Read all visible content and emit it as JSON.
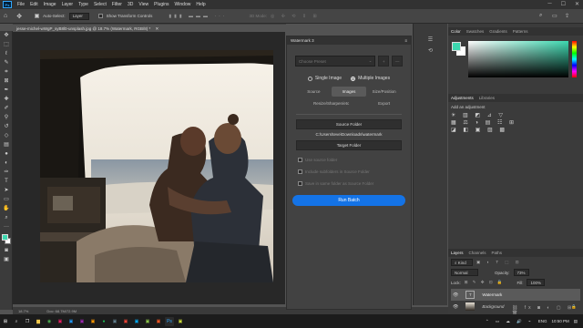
{
  "menu": {
    "app_badge": "Ps",
    "items": [
      "File",
      "Edit",
      "Image",
      "Layer",
      "Type",
      "Select",
      "Filter",
      "3D",
      "View",
      "Plugins",
      "Window",
      "Help"
    ]
  },
  "options_bar": {
    "auto_select_label": "Auto-Select:",
    "auto_select_value": "Layer",
    "show_transform_label": "Show Transform Controls",
    "mode_3d_label": "3D Mode:"
  },
  "document": {
    "tab_title": "jesse-michel-wWgP_syB8l0-unsplash.jpg @ 18.7% (Watermark, RGB/8) *",
    "zoom": "18.7%",
    "doc_size": "Doc: 68.7M/72.9M"
  },
  "watermark_panel": {
    "title": "Watermark 3",
    "preset_placeholder": "Choose Preset",
    "add_label": "+",
    "remove_label": "—",
    "single_image": "Single Image",
    "multiple_images": "Multiple Images",
    "tabs": [
      "Source",
      "Images",
      "Size/Position",
      "Resize/Sharpen/etc",
      "Export"
    ],
    "active_tab": "Images",
    "source_folder_btn": "Source Folder",
    "source_path": "C:\\Users\\teve\\Downloads\\watermark",
    "target_folder_btn": "Target Folder",
    "options": [
      "Use source folder",
      "Include subfolders in Source Folder",
      "Save in same folder as Source Folder"
    ],
    "run_batch": "Run Batch"
  },
  "color_panel": {
    "tabs": [
      "Color",
      "Swatches",
      "Gradients",
      "Patterns"
    ],
    "accent": "#31a8ff",
    "foreground": "#3dd8b0",
    "background": "#ffffff"
  },
  "adjustments_panel": {
    "tabs": [
      "Adjustments",
      "Libraries"
    ],
    "add_label": "Add an adjustment"
  },
  "layers_panel": {
    "tabs": [
      "Layers",
      "Channels",
      "Paths"
    ],
    "kind_label": "Kind",
    "blend_mode": "Normal",
    "opacity_label": "Opacity:",
    "opacity_value": "73%",
    "lock_label": "Lock:",
    "fill_label": "Fill:",
    "fill_value": "100%",
    "layers": [
      {
        "name": "Watermark",
        "selected": true
      },
      {
        "name": "Background",
        "selected": false
      }
    ]
  },
  "taskbar": {
    "language": "ENG",
    "time": "10:50 PM"
  }
}
